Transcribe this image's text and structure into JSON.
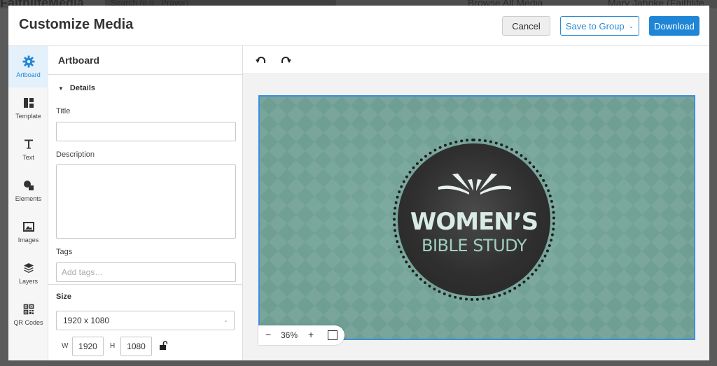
{
  "background_app": {
    "brand": "FaithlifeMedia",
    "search_placeholder": "Search (e.g., Prayer)",
    "browse_label": "Browse All Media",
    "user_name": "Mary Jahnke (Faithlife"
  },
  "header": {
    "title": "Customize Media",
    "cancel_label": "Cancel",
    "save_group_label": "Save to Group",
    "download_label": "Download"
  },
  "rail": {
    "items": [
      {
        "label": "Artboard",
        "icon": "gear-icon",
        "active": true
      },
      {
        "label": "Template",
        "icon": "template-icon",
        "active": false
      },
      {
        "label": "Text",
        "icon": "text-icon",
        "active": false
      },
      {
        "label": "Elements",
        "icon": "shapes-icon",
        "active": false
      },
      {
        "label": "Images",
        "icon": "image-icon",
        "active": false
      },
      {
        "label": "Layers",
        "icon": "layers-icon",
        "active": false
      },
      {
        "label": "QR Codes",
        "icon": "qr-code-icon",
        "active": false
      }
    ]
  },
  "panel": {
    "title": "Artboard",
    "details_label": "Details",
    "title_field": {
      "label": "Title",
      "value": ""
    },
    "description_field": {
      "label": "Description",
      "value": ""
    },
    "tags_field": {
      "label": "Tags",
      "placeholder": "Add tags…"
    },
    "size": {
      "label": "Size",
      "selected": "1920 x 1080",
      "width_label": "W",
      "width": "1920",
      "height_label": "H",
      "height": "1080"
    }
  },
  "artboard": {
    "line1": "WOMEN’S",
    "line2": "BIBLE STUDY",
    "accent_color": "#1f85d6",
    "bg_color": "#6f9e92"
  },
  "zoom": {
    "minus": "−",
    "level": "36%",
    "plus": "+"
  }
}
